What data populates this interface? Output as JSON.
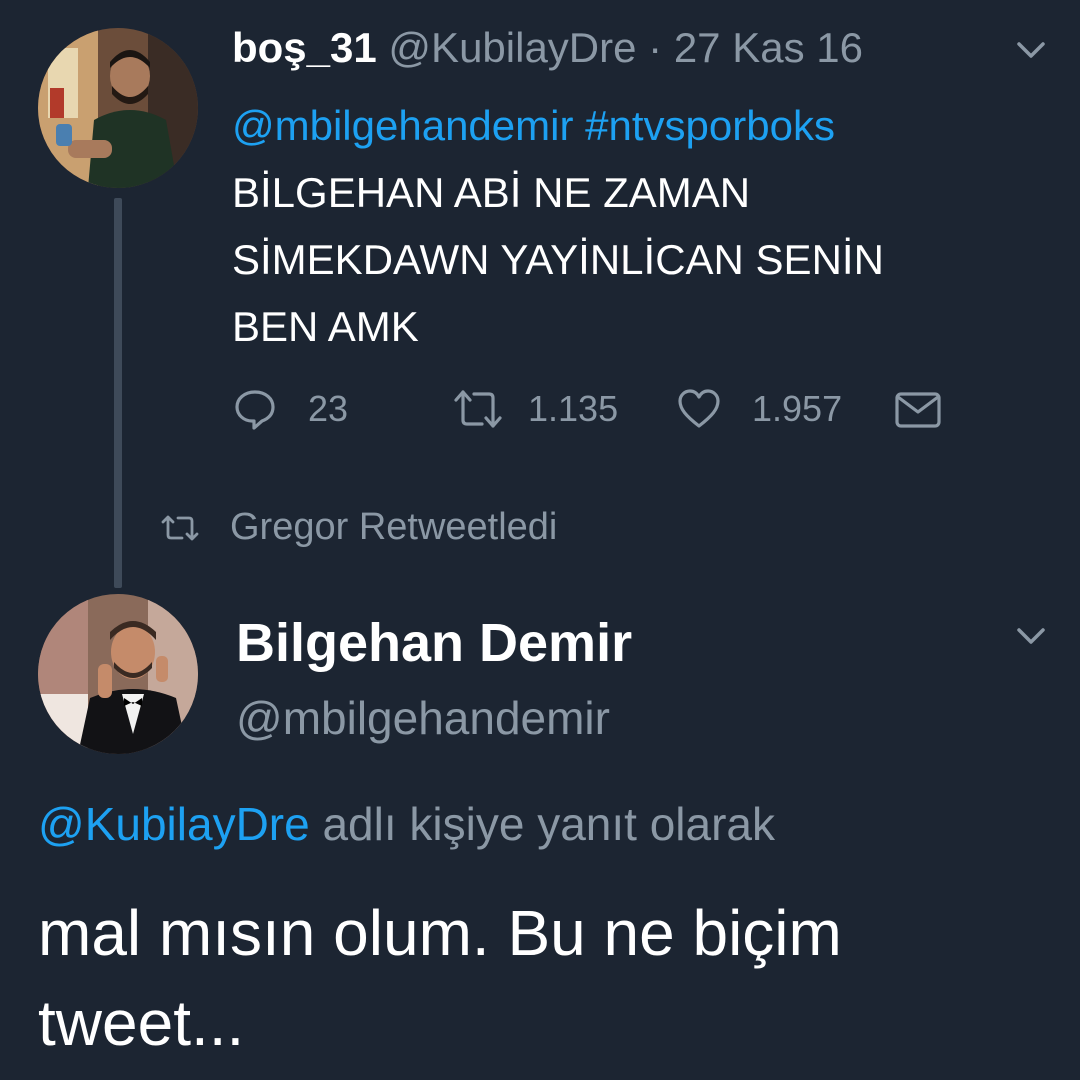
{
  "tweet1": {
    "display_name": "boş_31",
    "handle": "@KubilayDre",
    "separator": "·",
    "date": "27 Kas 16",
    "mention": "@mbilgehandemir",
    "hashtag": "#ntvsporboks",
    "text_lines": [
      "BİLGEHAN ABİ NE ZAMAN",
      "SİMEKDAWN YAYİNLİCAN SENİN",
      "BEN AMK"
    ],
    "replies": "23",
    "retweets": "1.135",
    "likes": "1.957"
  },
  "retweet_context": {
    "label": "Gregor Retweetledi"
  },
  "tweet2": {
    "display_name": "Bilgehan Demir",
    "handle": "@mbilgehandemir",
    "reply_to_handle": "@KubilayDre",
    "reply_to_suffix": "adlı kişiye yanıt olarak",
    "text": "mal mısın olum. Bu ne biçim tweet..."
  },
  "colors": {
    "background": "#1c2532",
    "link": "#1da1f2",
    "muted": "#8b98a5",
    "text": "#ffffff"
  },
  "icons": [
    "chevron-down-icon",
    "reply-icon",
    "retweet-icon",
    "like-icon",
    "direct-message-icon",
    "retweet-small-icon"
  ]
}
